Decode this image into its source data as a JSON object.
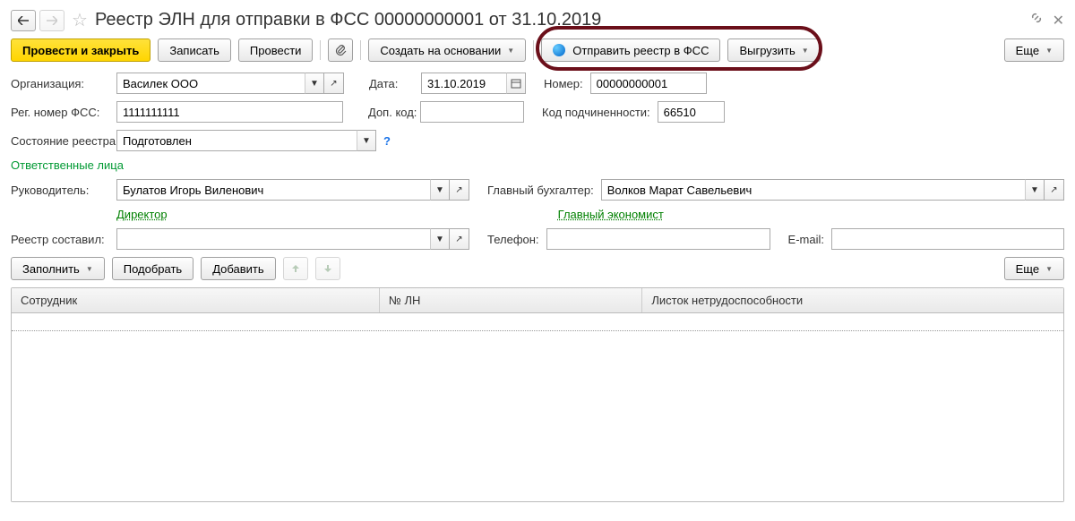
{
  "header": {
    "title": "Реестр ЭЛН для отправки в ФСС 00000000001 от 31.10.2019"
  },
  "toolbar": {
    "post_close": "Провести и закрыть",
    "save": "Записать",
    "post": "Провести",
    "create_based": "Создать на основании",
    "send_registry": "Отправить реестр в ФСС",
    "export": "Выгрузить",
    "more": "Еще"
  },
  "form": {
    "org_label": "Организация:",
    "org_value": "Василек ООО",
    "date_label": "Дата:",
    "date_value": "31.10.2019",
    "number_label": "Номер:",
    "number_value": "00000000001",
    "fss_reg_label": "Рег. номер ФСС:",
    "fss_reg_value": "1111111111",
    "extra_code_label": "Доп. код:",
    "extra_code_value": "",
    "sub_code_label": "Код подчиненности:",
    "sub_code_value": "66510",
    "status_label": "Состояние реестра:",
    "status_value": "Подготовлен"
  },
  "responsibles": {
    "section": "Ответственные лица",
    "head_label": "Руководитель:",
    "head_value": "Булатов Игорь Виленович",
    "head_link": "Директор",
    "accountant_label": "Главный бухгалтер:",
    "accountant_value": "Волков Марат Савельевич",
    "accountant_link": "Главный экономист",
    "compiled_label": "Реестр составил:",
    "compiled_value": "",
    "phone_label": "Телефон:",
    "phone_value": "",
    "email_label": "E-mail:",
    "email_value": ""
  },
  "list_toolbar": {
    "fill": "Заполнить",
    "pick": "Подобрать",
    "add": "Добавить",
    "more": "Еще"
  },
  "table": {
    "col_employee": "Сотрудник",
    "col_ln_number": "№ ЛН",
    "col_disability": "Листок нетрудоспособности"
  }
}
